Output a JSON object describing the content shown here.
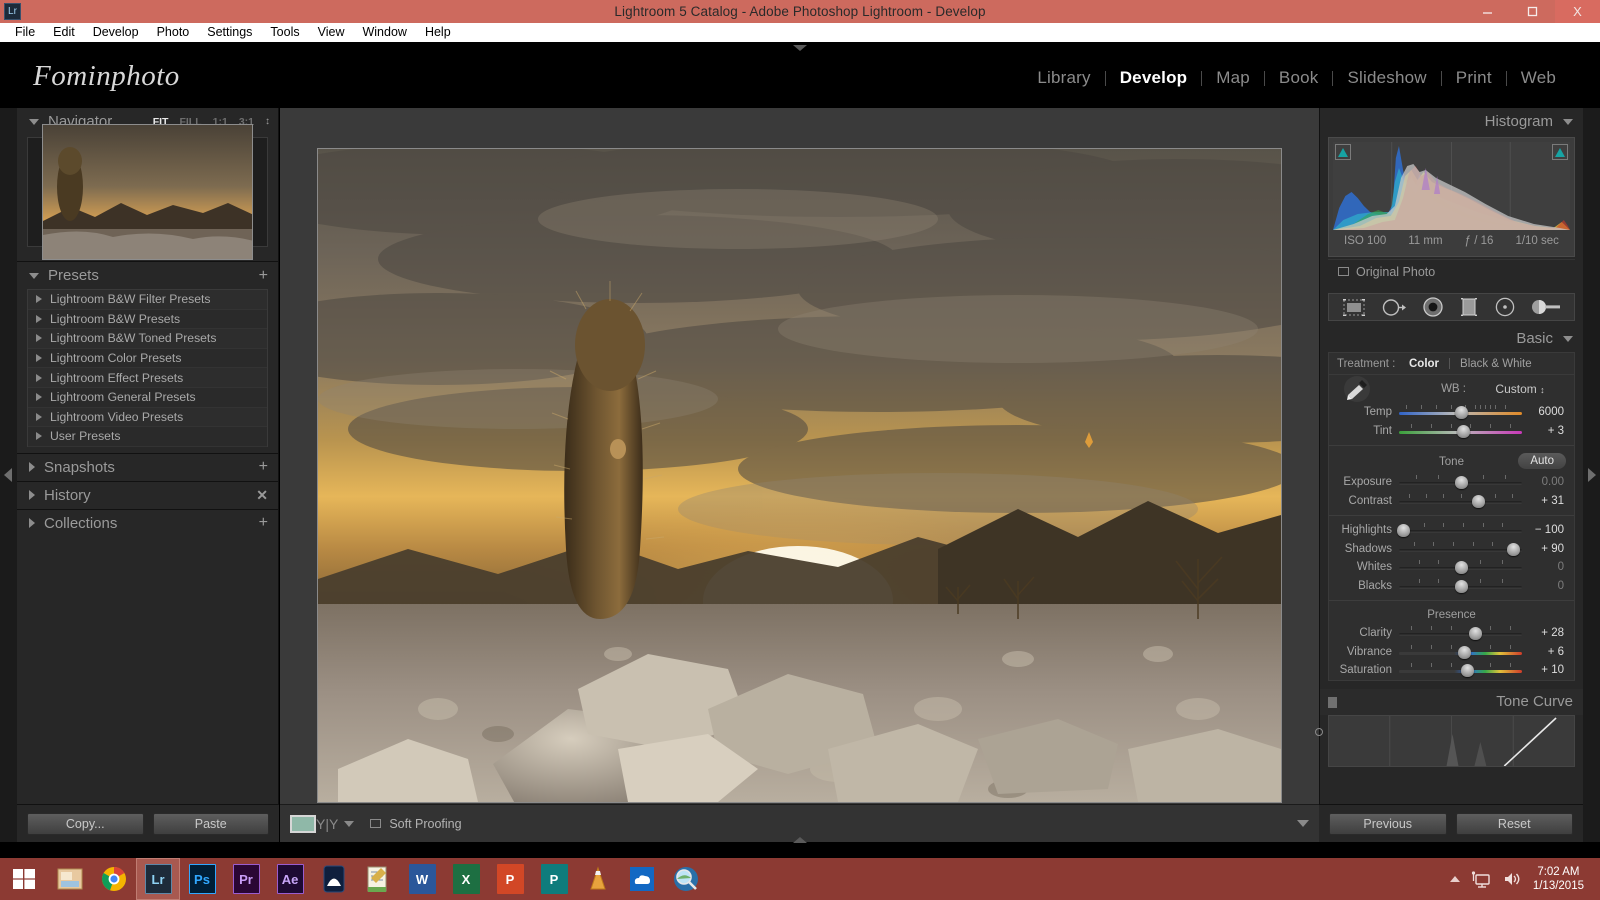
{
  "window": {
    "title": "Lightroom 5 Catalog - Adobe Photoshop Lightroom - Develop",
    "app_icon_label": "Lr",
    "minimize": "minimize-icon",
    "maximize": "maximize-icon",
    "close": "X"
  },
  "menubar": {
    "items": [
      "File",
      "Edit",
      "Develop",
      "Photo",
      "Settings",
      "Tools",
      "View",
      "Window",
      "Help"
    ]
  },
  "identity_plate": "Fominphoto",
  "modules": [
    {
      "label": "Library",
      "active": false
    },
    {
      "label": "Develop",
      "active": true
    },
    {
      "label": "Map",
      "active": false
    },
    {
      "label": "Book",
      "active": false
    },
    {
      "label": "Slideshow",
      "active": false
    },
    {
      "label": "Print",
      "active": false
    },
    {
      "label": "Web",
      "active": false
    }
  ],
  "left_panel": {
    "navigator": {
      "title": "Navigator",
      "zoom_options": [
        {
          "label": "FIT",
          "selected": true
        },
        {
          "label": "FILL",
          "selected": false
        },
        {
          "label": "1:1",
          "selected": false
        },
        {
          "label": "3:1",
          "selected": false
        }
      ]
    },
    "presets": {
      "title": "Presets",
      "add_label": "+",
      "items": [
        "Lightroom B&W Filter Presets",
        "Lightroom B&W Presets",
        "Lightroom B&W Toned Presets",
        "Lightroom Color Presets",
        "Lightroom Effect Presets",
        "Lightroom General Presets",
        "Lightroom Video Presets",
        "User Presets"
      ]
    },
    "snapshots": {
      "title": "Snapshots",
      "action": "+"
    },
    "history": {
      "title": "History",
      "action": "✕"
    },
    "collections": {
      "title": "Collections",
      "action": "+"
    },
    "buttons": {
      "copy": "Copy...",
      "paste": "Paste"
    }
  },
  "right_panel": {
    "histogram": {
      "title": "Histogram",
      "exif": {
        "iso": "ISO 100",
        "focal_length": "11 mm",
        "aperture": "ƒ / 16",
        "shutter": "1/10 sec"
      },
      "original_photo_label": "Original Photo"
    },
    "tools": [
      "crop-overlay-icon",
      "spot-removal-icon",
      "red-eye-icon",
      "graduated-filter-icon",
      "radial-filter-icon",
      "adjustment-brush-icon"
    ],
    "basic": {
      "title": "Basic",
      "treatment_label": "Treatment :",
      "treatment_options": [
        {
          "label": "Color",
          "selected": true
        },
        {
          "label": "Black & White",
          "selected": false
        }
      ],
      "wb_label": "WB :",
      "wb_value": "Custom",
      "white_balance": [
        {
          "name": "Temp",
          "value": "6000",
          "pos": 50,
          "zero": false,
          "grad": "temp"
        },
        {
          "name": "Tint",
          "value": "+ 3",
          "pos": 52,
          "zero": false,
          "grad": "tint"
        }
      ],
      "tone_title": "Tone",
      "auto_label": "Auto",
      "tone": [
        {
          "name": "Exposure",
          "value": "0.00",
          "pos": 50,
          "zero": true,
          "grad": "plain"
        },
        {
          "name": "Contrast",
          "value": "+ 31",
          "pos": 64,
          "zero": false,
          "grad": "plain"
        }
      ],
      "tone2": [
        {
          "name": "Highlights",
          "value": "− 100",
          "pos": 2,
          "zero": false,
          "grad": "plain"
        },
        {
          "name": "Shadows",
          "value": "+ 90",
          "pos": 93,
          "zero": false,
          "grad": "plain"
        },
        {
          "name": "Whites",
          "value": "0",
          "pos": 50,
          "zero": true,
          "grad": "plain"
        },
        {
          "name": "Blacks",
          "value": "0",
          "pos": 50,
          "zero": true,
          "grad": "plain"
        }
      ],
      "presence_title": "Presence",
      "presence": [
        {
          "name": "Clarity",
          "value": "+ 28",
          "pos": 62,
          "zero": false,
          "grad": "plain"
        },
        {
          "name": "Vibrance",
          "value": "+ 6",
          "pos": 53,
          "zero": false,
          "grad": "rainbow"
        },
        {
          "name": "Saturation",
          "value": "+ 10",
          "pos": 55,
          "zero": false,
          "grad": "rainbow"
        }
      ]
    },
    "tone_curve": {
      "title": "Tone Curve"
    },
    "buttons": {
      "previous": "Previous",
      "reset": "Reset"
    }
  },
  "toolbar": {
    "soft_proofing_label": "Soft Proofing",
    "view_icon": "loupe-view-icon",
    "compare_icon": "before-after-icon"
  },
  "taskbar": {
    "start_label": "start-button",
    "items": [
      {
        "name": "file-explorer",
        "label": "",
        "bg": "#e8c9a0",
        "fg": "#5a3a10",
        "glyph": "▤",
        "active": false
      },
      {
        "name": "google-chrome",
        "label": "",
        "bg": "#ffffff",
        "fg": "#cc2a28",
        "glyph": "◉",
        "active": false
      },
      {
        "name": "adobe-lightroom",
        "label": "Lr",
        "bg": "#1d2b3a",
        "fg": "#8fd3f4",
        "glyph": "",
        "active": true
      },
      {
        "name": "adobe-photoshop",
        "label": "Ps",
        "bg": "#001e36",
        "fg": "#31a8ff",
        "glyph": "",
        "active": false
      },
      {
        "name": "adobe-premiere",
        "label": "Pr",
        "bg": "#2a0634",
        "fg": "#b07cf0",
        "glyph": "",
        "active": false
      },
      {
        "name": "adobe-after-effects",
        "label": "Ae",
        "bg": "#1d0a33",
        "fg": "#b18cf0",
        "glyph": "",
        "active": false
      },
      {
        "name": "nikon-viewnx",
        "label": "",
        "bg": "#0f1f3d",
        "fg": "#ffffff",
        "glyph": "◓",
        "active": false
      },
      {
        "name": "notepad-app",
        "label": "",
        "bg": "#f2efe0",
        "fg": "#4a7a2a",
        "glyph": "✎",
        "active": false
      },
      {
        "name": "microsoft-word",
        "label": "W",
        "bg": "#2b579a",
        "fg": "#ffffff",
        "glyph": "",
        "active": false
      },
      {
        "name": "microsoft-excel",
        "label": "X",
        "bg": "#1d6f42",
        "fg": "#ffffff",
        "glyph": "",
        "active": false
      },
      {
        "name": "microsoft-powerpoint",
        "label": "P",
        "bg": "#d24726",
        "fg": "#ffffff",
        "glyph": "",
        "active": false
      },
      {
        "name": "microsoft-publisher",
        "label": "P",
        "bg": "#0f7c7c",
        "fg": "#ffffff",
        "glyph": "",
        "active": false
      },
      {
        "name": "vlc-media-player",
        "label": "",
        "bg": "transparent",
        "fg": "#e8a33d",
        "glyph": "▲",
        "active": false
      },
      {
        "name": "onedrive-app",
        "label": "",
        "bg": "#1268c3",
        "fg": "#ffffff",
        "glyph": "☁",
        "active": false
      },
      {
        "name": "search-everything",
        "label": "",
        "bg": "#2a6fa8",
        "fg": "#cfe8f7",
        "glyph": "◍",
        "active": false
      }
    ],
    "tray": {
      "network_icon": "network-icon",
      "volume_icon": "volume-icon",
      "time": "7:02 AM",
      "date": "1/13/2015"
    }
  }
}
